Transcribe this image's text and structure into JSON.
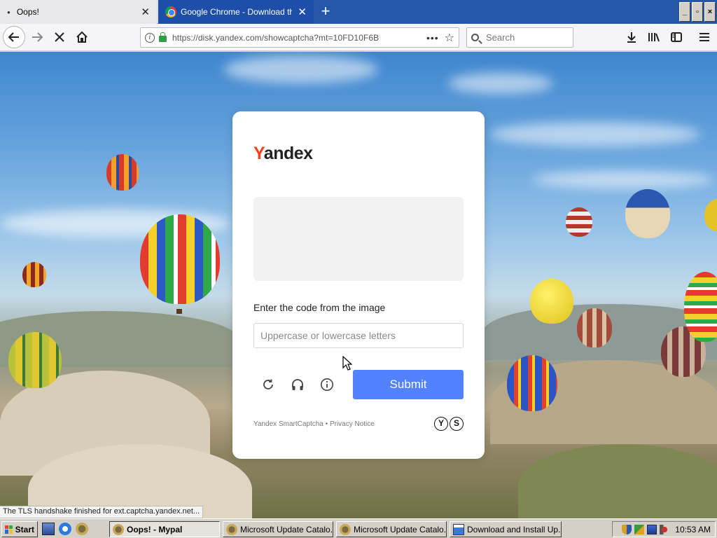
{
  "browser": {
    "tabs": [
      {
        "title": "Oops!",
        "active": true
      },
      {
        "title": "Google Chrome - Download the Fa",
        "active": false
      }
    ],
    "new_tab_glyph": "+",
    "window_buttons": [
      "_",
      "▫",
      "×"
    ],
    "url": "https://disk.yandex.com/showcaptcha?mt=10FD10F6B",
    "search_placeholder": "Search",
    "nav_icons": [
      "back-arrow-icon",
      "forward-arrow-icon",
      "stop-icon",
      "home-icon"
    ],
    "toolbar_icons": [
      "download-icon",
      "library-icon",
      "sidebar-icon",
      "menu-icon"
    ],
    "status_text": "The TLS handshake finished for ext.captcha.yandex.net..."
  },
  "captcha": {
    "logo_first": "Y",
    "logo_rest": "andex",
    "label": "Enter the code from the image",
    "input_placeholder": "Uppercase or lowercase letters",
    "input_value": "",
    "submit_label": "Submit",
    "footer_brand": "Yandex SmartCaptcha",
    "footer_separator": " • ",
    "footer_privacy": "Privacy Notice",
    "smartcaptcha_logo": [
      "Y",
      "S"
    ],
    "icons": [
      "refresh-icon",
      "audio-headphones-icon",
      "info-icon"
    ],
    "colors": {
      "submit": "#5282ff",
      "logo_y": "#fc3f1d"
    }
  },
  "taskbar": {
    "start_label": "Start",
    "items": [
      {
        "label": "Oops! - Mypal",
        "active": true
      },
      {
        "label": "Microsoft Update Catalo...",
        "active": false
      },
      {
        "label": "Microsoft Update Catalo...",
        "active": false
      },
      {
        "label": "Download and Install Up...",
        "active": false
      }
    ],
    "clock": "10:53 AM"
  }
}
